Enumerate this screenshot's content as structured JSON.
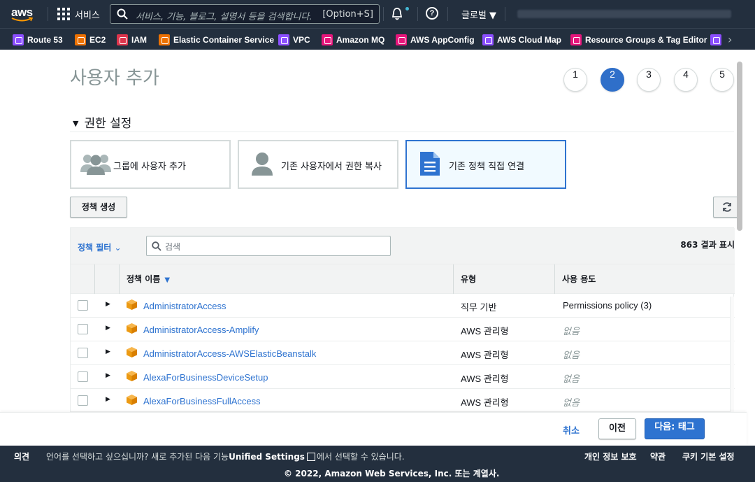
{
  "topbar": {
    "logo_text": "aws",
    "services_label": "서비스",
    "search_placeholder": "서비스, 기능, 블로그, 설명서 등을 검색합니다.",
    "search_shortcut": "[Option+S]",
    "region_label": "글로벌 ▼"
  },
  "favorites": [
    {
      "label": "Route 53",
      "color": "#8c4fff"
    },
    {
      "label": "EC2",
      "color": "#ed7100"
    },
    {
      "label": "IAM",
      "color": "#dd344c"
    },
    {
      "label": "Elastic Container Service",
      "color": "#ed7100"
    },
    {
      "label": "VPC",
      "color": "#8c4fff"
    },
    {
      "label": "Amazon MQ",
      "color": "#e7157b"
    },
    {
      "label": "AWS AppConfig",
      "color": "#e7157b"
    },
    {
      "label": "AWS Cloud Map",
      "color": "#8c4fff"
    },
    {
      "label": "Resource Groups & Tag Editor",
      "color": "#e7157b"
    }
  ],
  "page": {
    "title": "사용자 추가",
    "steps": [
      "1",
      "2",
      "3",
      "4",
      "5"
    ],
    "active_step": "2",
    "section_title": "권한 설정"
  },
  "options": {
    "add_to_group": "그룹에 사용자 추가",
    "copy_permissions": "기존 사용자에서 권한 복사",
    "attach_policies": "기존 정책 직접 연결"
  },
  "toolbar": {
    "create_policy": "정책 생성"
  },
  "table": {
    "filter_label": "정책 필터",
    "search_placeholder": "검색",
    "result_count": "863 결과 표시",
    "headers": {
      "name": "정책 이름",
      "type": "유형",
      "usage": "사용 용도"
    },
    "rows": [
      {
        "name": "AdministratorAccess",
        "type": "직무 기반",
        "usage": "Permissions policy (3)"
      },
      {
        "name": "AdministratorAccess-Amplify",
        "type": "AWS 관리형",
        "usage": "없음"
      },
      {
        "name": "AdministratorAccess-AWSElasticBeanstalk",
        "type": "AWS 관리형",
        "usage": "없음"
      },
      {
        "name": "AlexaForBusinessDeviceSetup",
        "type": "AWS 관리형",
        "usage": "없음"
      },
      {
        "name": "AlexaForBusinessFullAccess",
        "type": "AWS 관리형",
        "usage": "없음"
      }
    ]
  },
  "actions": {
    "cancel": "취소",
    "previous": "이전",
    "next": "다음: 태그"
  },
  "footer": {
    "feedback": "의견",
    "language_prefix": "언어를 선택하고 싶으십니까? 새로 추가된 다음 기능",
    "unified_settings": "Unified Settings",
    "language_suffix": "에서 선택할 수 있습니다.",
    "privacy": "개인 정보 보호",
    "terms": "약관",
    "cookies": "쿠키 기본 설정",
    "copyright": "© 2022, Amazon Web Services, Inc. 또는 계열사."
  }
}
